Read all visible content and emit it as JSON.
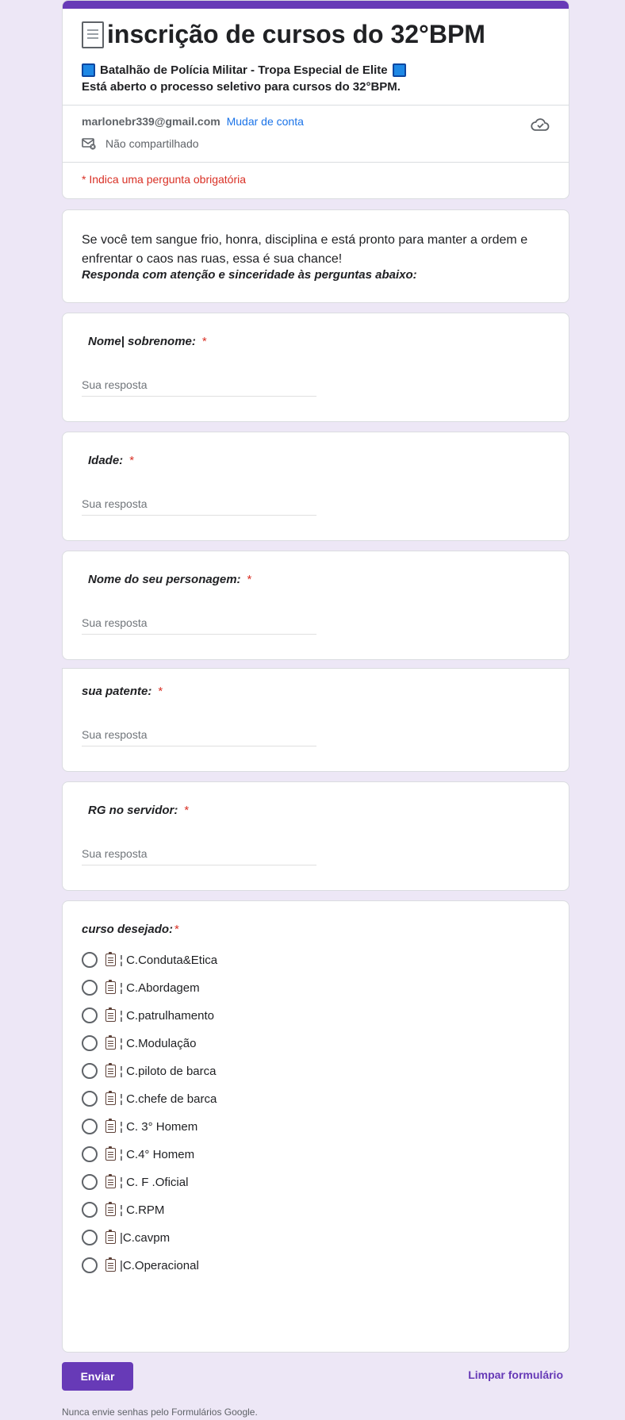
{
  "form": {
    "title": "inscrição de cursos do 32°BPM",
    "subtitle_line1": "Batalhão de Polícia Militar - Tropa Especial de Elite",
    "subtitle_line2": "Está aberto o processo seletivo para cursos do 32°BPM.",
    "account_email": "marlonebr339@gmail.com",
    "switch_account": "Mudar de conta",
    "not_shared": "Não compartilhado",
    "required_note": "* Indica uma pergunta obrigatória",
    "accent_color": "#673ab7",
    "background_color": "#ede7f6"
  },
  "intro": {
    "text": "Se você tem sangue frio, honra, disciplina e está pronto para manter a ordem e enfrentar o caos nas ruas, essa é sua chance!",
    "emphasis": "Responda com atenção e sinceridade às perguntas abaixo:"
  },
  "questions": [
    {
      "title": "Nome| sobrenome:",
      "required": "*",
      "placeholder": "Sua resposta"
    },
    {
      "title": "Idade:",
      "required": "*",
      "placeholder": "Sua resposta"
    },
    {
      "title": "Nome do seu personagem:",
      "required": "*",
      "placeholder": "Sua resposta"
    },
    {
      "title": "sua patente:",
      "required": "*",
      "placeholder": "Sua resposta"
    },
    {
      "title": "RG no servidor:",
      "required": "*",
      "placeholder": "Sua resposta"
    }
  ],
  "course": {
    "title": "curso desejado:",
    "required": "*",
    "options": [
      "¦ C.Conduta&Etica",
      "¦ C.Abordagem",
      "¦ C.patrulhamento",
      "¦ C.Modulação",
      "¦ C.piloto de barca",
      "¦ C.chefe de barca",
      "¦ C. 3° Homem",
      "¦ C.4° Homem",
      "¦ C. F .Oficial",
      "¦ C.RPM",
      "|C.cavpm",
      "|C.Operacional"
    ]
  },
  "actions": {
    "submit": "Enviar",
    "clear": "Limpar formulário"
  },
  "footer": {
    "note": "Nunca envie senhas pelo Formulários Google."
  }
}
